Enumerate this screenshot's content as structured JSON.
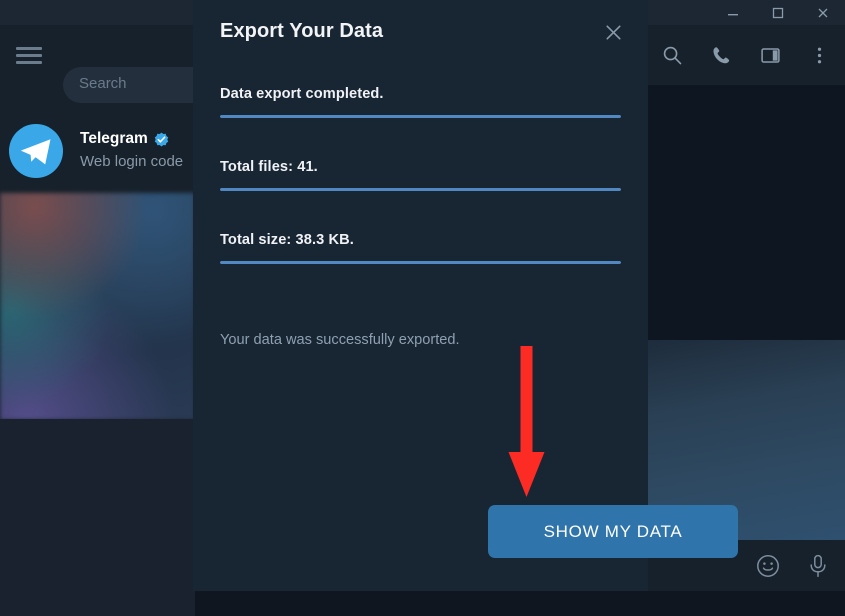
{
  "window": {
    "controls": [
      {
        "name": "minimize",
        "glyph": "minimize-icon"
      },
      {
        "name": "maximize",
        "glyph": "maximize-icon"
      },
      {
        "name": "close",
        "glyph": "close-icon"
      }
    ]
  },
  "sidebar": {
    "menu_icon": "hamburger-icon",
    "search": {
      "placeholder": "Search",
      "value": ""
    },
    "chats": [
      {
        "name": "Telegram",
        "verified": true,
        "snippet": "Web login code",
        "avatar_icon": "telegram-logo-icon",
        "avatar_color": "#3aa8e8"
      }
    ]
  },
  "chat_toolbar": {
    "icons": [
      {
        "name": "search-icon"
      },
      {
        "name": "phone-icon"
      },
      {
        "name": "panel-icon"
      },
      {
        "name": "more-vertical-icon"
      }
    ]
  },
  "composer": {
    "icons": [
      {
        "name": "emoji-icon"
      },
      {
        "name": "microphone-icon"
      }
    ]
  },
  "dialog": {
    "title": "Export Your Data",
    "close_label": "close-icon",
    "progress_rows": [
      {
        "label": "Data export completed.",
        "percent": 100
      },
      {
        "label": "Total files: 41.",
        "percent": 100
      },
      {
        "label": "Total size: 38.3 KB.",
        "percent": 100
      }
    ],
    "status": "Your data was successfully exported.",
    "primary_button": "SHOW MY DATA"
  },
  "annotation": {
    "arrow_color": "#fc2b24",
    "arrow_direction": "down",
    "points_to": "SHOW MY DATA"
  },
  "colors": {
    "accent": "#5288c1",
    "button": "#2f74ab",
    "dialog_bg": "#182533",
    "app_bg": "#17212b",
    "chat_bg": "#0e1621",
    "text_primary": "#f0f2f5",
    "text_secondary": "#8fa0b0",
    "arrow_red": "#fc2b24"
  }
}
